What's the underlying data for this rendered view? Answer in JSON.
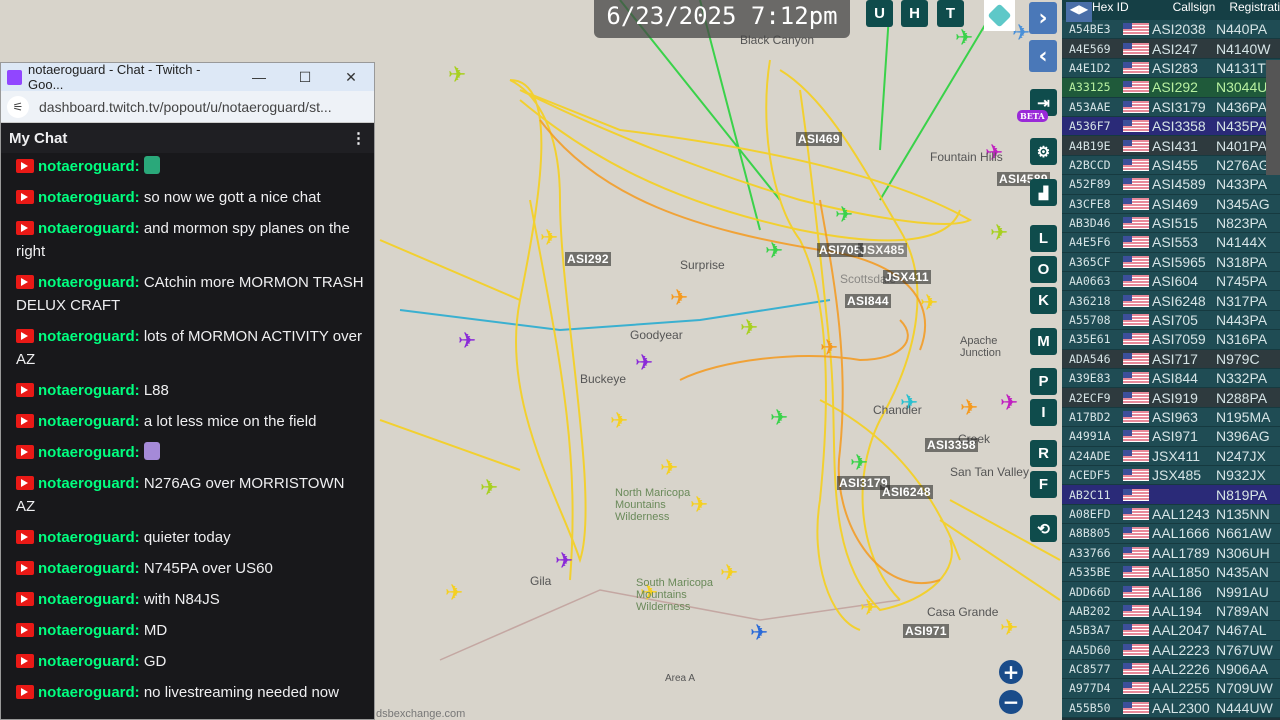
{
  "map": {
    "datetime": "6/23/2025 7:12pm",
    "buttons_top": [
      "U",
      "H",
      "T"
    ],
    "buttons_side": [
      "L",
      "O",
      "K",
      "M",
      "P",
      "I",
      "R",
      "F"
    ],
    "beta_badge": "BETA",
    "attribution": "dsbexchange.com",
    "aircraft_labels": [
      "ASI469",
      "ASI292",
      "ASI705",
      "JSX485",
      "JSX411",
      "ASI844",
      "ASI3358",
      "ASI3179",
      "ASI6248",
      "ASI971",
      "ASI4589"
    ],
    "places": [
      "Black Canyon",
      "Surprise",
      "Goodyear",
      "Buckeye",
      "Scottsdale",
      "Fountain Hills",
      "Apache Junction",
      "Chandler",
      "Creek",
      "San Tan Valley",
      "North Maricopa Mountains Wilderness",
      "South Maricopa Mountains Wilderness",
      "Gila",
      "Casa Grande",
      "Area A"
    ],
    "colors": {
      "track_yellow": "#f5d020",
      "track_orange": "#f59a1e",
      "track_green": "#3ad24a"
    }
  },
  "chat_window": {
    "title": "notaeroguard - Chat - Twitch - Goo...",
    "url": "dashboard.twitch.tv/popout/u/notaeroguard/st...",
    "header": "My Chat",
    "messages": [
      {
        "user": "notaeroguard:",
        "text": "",
        "emote": "#2aa87a"
      },
      {
        "user": "notaeroguard:",
        "text": "so now we gott a nice chat"
      },
      {
        "user": "notaeroguard:",
        "text": "and mormon spy planes on the right"
      },
      {
        "user": "notaeroguard:",
        "text": "CAtchin more MORMON TRASH DELUX CRAFT"
      },
      {
        "user": "notaeroguard:",
        "text": "lots of MORMON ACTIVITY over AZ"
      },
      {
        "user": "notaeroguard:",
        "text": "L88"
      },
      {
        "user": "notaeroguard:",
        "text": "a lot less mice on the field"
      },
      {
        "user": "notaeroguard:",
        "text": "",
        "emote": "#a58ad8"
      },
      {
        "user": "notaeroguard:",
        "text": "N276AG over MORRISTOWN AZ"
      },
      {
        "user": "notaeroguard:",
        "text": "quieter today"
      },
      {
        "user": "notaeroguard:",
        "text": "N745PA over US60"
      },
      {
        "user": "notaeroguard:",
        "text": "with N84JS"
      },
      {
        "user": "notaeroguard:",
        "text": "MD"
      },
      {
        "user": "notaeroguard:",
        "text": "GD"
      },
      {
        "user": "notaeroguard:",
        "text": "no livestreaming needed now"
      }
    ]
  },
  "aircraft_table": {
    "headers": [
      "Hex ID",
      "",
      "Callsign",
      "Registrati"
    ],
    "rows": [
      [
        "A54BE3",
        "ASI2038",
        "N440PA",
        ""
      ],
      [
        "A4E569",
        "ASI247",
        "N4140W",
        "alt"
      ],
      [
        "A4E1D2",
        "ASI283",
        "N4131T",
        ""
      ],
      [
        "A33125",
        "ASI292",
        "N3044U",
        "green"
      ],
      [
        "A53AAE",
        "ASI3179",
        "N436PA",
        ""
      ],
      [
        "A536F7",
        "ASI3358",
        "N435PA",
        "purple"
      ],
      [
        "A4B19E",
        "ASI431",
        "N401PA",
        "alt"
      ],
      [
        "A2BCCD",
        "ASI455",
        "N276AG",
        ""
      ],
      [
        "A52F89",
        "ASI4589",
        "N433PA",
        ""
      ],
      [
        "A3CFE8",
        "ASI469",
        "N345AG",
        ""
      ],
      [
        "AB3D46",
        "ASI515",
        "N823PA",
        ""
      ],
      [
        "A4E5F6",
        "ASI553",
        "N4144X",
        ""
      ],
      [
        "A365CF",
        "ASI5965",
        "N318PA",
        ""
      ],
      [
        "AA0663",
        "ASI604",
        "N745PA",
        ""
      ],
      [
        "A36218",
        "ASI6248",
        "N317PA",
        ""
      ],
      [
        "A55708",
        "ASI705",
        "N443PA",
        ""
      ],
      [
        "A35E61",
        "ASI7059",
        "N316PA",
        ""
      ],
      [
        "ADA546",
        "ASI717",
        "N979C",
        "alt"
      ],
      [
        "A39E83",
        "ASI844",
        "N332PA",
        ""
      ],
      [
        "A2ECF9",
        "ASI919",
        "N288PA",
        "alt"
      ],
      [
        "A17BD2",
        "ASI963",
        "N195MA",
        ""
      ],
      [
        "A4991A",
        "ASI971",
        "N396AG",
        ""
      ],
      [
        "A24ADE",
        "JSX411",
        "N247JX",
        ""
      ],
      [
        "ACEDF5",
        "JSX485",
        "N932JX",
        ""
      ],
      [
        "AB2C11",
        "",
        "N819PA",
        "purple"
      ],
      [
        "A08EFD",
        "AAL1243",
        "N135NN",
        ""
      ],
      [
        "A8B805",
        "AAL1666",
        "N661AW",
        ""
      ],
      [
        "A33766",
        "AAL1789",
        "N306UH",
        ""
      ],
      [
        "A535BE",
        "AAL1850",
        "N435AN",
        ""
      ],
      [
        "ADD66D",
        "AAL186",
        "N991AU",
        ""
      ],
      [
        "AAB202",
        "AAL194",
        "N789AN",
        ""
      ],
      [
        "A5B3A7",
        "AAL2047",
        "N467AL",
        ""
      ],
      [
        "AA5D60",
        "AAL2223",
        "N767UW",
        ""
      ],
      [
        "AC8577",
        "AAL2226",
        "N906AA",
        ""
      ],
      [
        "A977D4",
        "AAL2255",
        "N709UW",
        ""
      ],
      [
        "A55B50",
        "AAL2300",
        "N444UW",
        ""
      ]
    ]
  }
}
